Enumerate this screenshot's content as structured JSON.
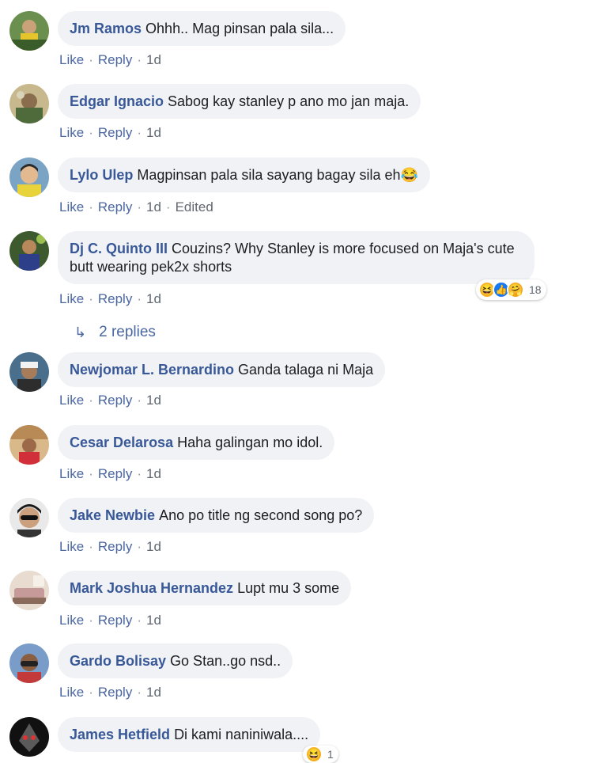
{
  "actions": {
    "like": "Like",
    "reply": "Reply",
    "sep": "·"
  },
  "comments": [
    {
      "name": "Jm Ramos",
      "text": "Ohhh.. Mag pinsan pala sila...",
      "time": "1d"
    },
    {
      "name": "Edgar Ignacio",
      "text": "Sabog kay stanley p ano mo jan maja.",
      "time": "1d"
    },
    {
      "name": "Lylo Ulep",
      "text": "Magpinsan pala sila sayang bagay sila eh😂",
      "time": "1d",
      "edited": "Edited"
    },
    {
      "name": "Dj C. Quinto III",
      "text": "Couzins? Why Stanley is more focused on Maja's cute butt wearing pek2x shorts",
      "time": "1d",
      "reaction_count": "18",
      "replies": "2 replies"
    },
    {
      "name": "Newjomar L. Bernardino",
      "text": "Ganda talaga ni Maja",
      "time": "1d"
    },
    {
      "name": "Cesar Delarosa",
      "text": "Haha galingan mo idol.",
      "time": "1d"
    },
    {
      "name": "Jake Newbie",
      "text": "Ano po title ng second song po?",
      "time": "1d"
    },
    {
      "name": "Mark Joshua Hernandez",
      "text": "Lupt mu 3 some",
      "time": "1d"
    },
    {
      "name": "Gardo Bolisay",
      "text": "Go Stan..go nsd..",
      "time": "1d"
    },
    {
      "name": "James Hetfield",
      "text": "Di kami naniniwala....",
      "reaction_count": "1"
    }
  ],
  "colors": {
    "name": "#385898",
    "bubble": "#f0f2f5",
    "link": "#4b67a1"
  }
}
